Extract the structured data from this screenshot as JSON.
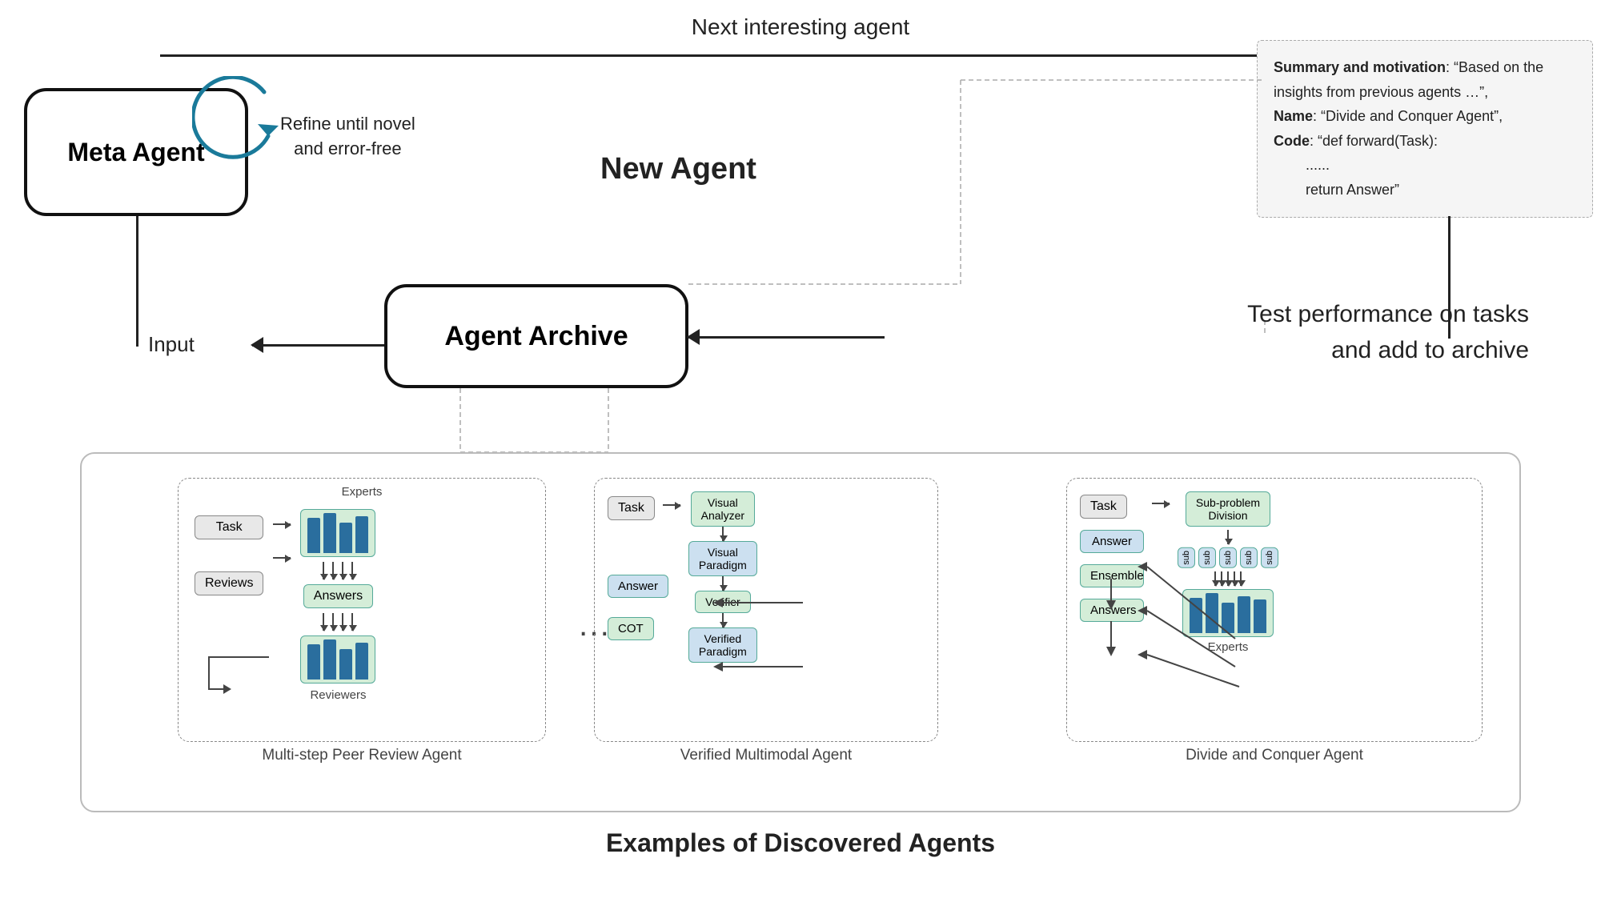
{
  "top_arrow": {
    "label": "Next interesting agent"
  },
  "meta_agent": {
    "label": "Meta Agent"
  },
  "refine": {
    "label": "Refine until novel\nand error-free"
  },
  "new_agent": {
    "label": "New Agent"
  },
  "new_agent_info": {
    "summary_bold": "Summary and motivation",
    "summary_text": ": “Based on the insights from previous agents …”,",
    "name_bold": "Name",
    "name_text": ": “Divide and Conquer Agent”,",
    "code_bold": "Code",
    "code_text": ": “def forward(Task):",
    "code_dots": "......",
    "code_return": "return Answer”"
  },
  "agent_archive": {
    "label": "Agent Archive"
  },
  "input_label": "Input",
  "test_perf": {
    "line1": "Test performance on tasks",
    "line2": "and add to archive"
  },
  "examples_title": "Examples of Discovered Agents",
  "sub_agents": [
    {
      "title": "Multi-step Peer Review Agent",
      "task_label": "Task",
      "reviews_label": "Reviews",
      "answers_label": "Answers",
      "reviewers_label": "Reviewers",
      "experts_label": "Experts"
    },
    {
      "title": "Verified Multimodal Agent",
      "task_label": "Task",
      "visual_analyzer_label": "Visual\nAnalyzer",
      "visual_paradigm_label": "Visual\nParadigm",
      "answer_label": "Answer",
      "verifier_label": "Verifier",
      "cot_label": "COT",
      "verified_paradigm_label": "Verified\nParadigm"
    },
    {
      "title": "Divide and Conquer Agent",
      "task_label": "Task",
      "answer_label": "Answer",
      "sub_problem_label": "Sub-problem\nDivision",
      "ensemble_label": "Ensemble",
      "answers_label": "Answers",
      "experts_label": "Experts",
      "sub_labels": [
        "sub",
        "sub",
        "sub",
        "sub",
        "sub"
      ]
    }
  ]
}
